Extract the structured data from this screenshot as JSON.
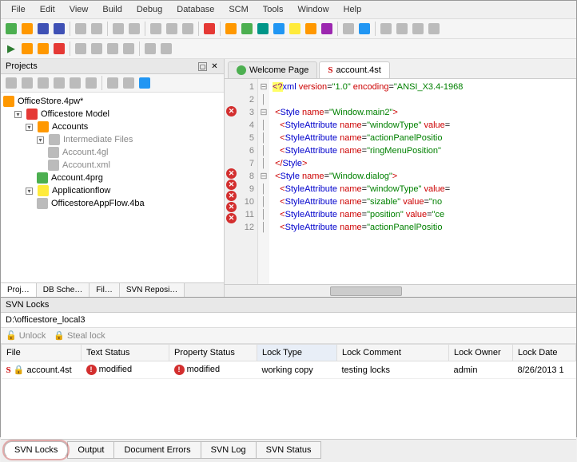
{
  "menu": [
    "File",
    "Edit",
    "View",
    "Build",
    "Debug",
    "Database",
    "SCM",
    "Tools",
    "Window",
    "Help"
  ],
  "projects": {
    "title": "Projects",
    "tabs": [
      "Proj…",
      "DB Sche…",
      "Fil…",
      "SVN Reposi…"
    ],
    "tree": {
      "root": "OfficeStore.4pw*",
      "n1": "Officestore Model",
      "n2": "Accounts",
      "n3": "Intermediate Files",
      "n4a": "Account.4gl",
      "n4b": "Account.xml",
      "n5": "Account.4prg",
      "n6": "Applicationflow",
      "n7": "OfficestoreAppFlow.4ba"
    }
  },
  "editor": {
    "tabs": {
      "welcome": "Welcome Page",
      "file": "account.4st"
    },
    "lines": [
      "1",
      "2",
      "3",
      "4",
      "5",
      "6",
      "7",
      "8",
      "9",
      "10",
      "11",
      "12"
    ]
  },
  "svn": {
    "title": "SVN Locks",
    "path": "D:\\officestore_local3",
    "tool_unlock": "Unlock",
    "tool_steal": "Steal lock",
    "cols": [
      "File",
      "Text Status",
      "Property Status",
      "Lock Type",
      "Lock Comment",
      "Lock Owner",
      "Lock Date"
    ],
    "row": {
      "file": "account.4st",
      "text_status": "modified",
      "prop_status": "modified",
      "lock_type": "working copy",
      "comment": "testing locks",
      "owner": "admin",
      "date": "8/26/2013 1"
    }
  },
  "footer_tabs": [
    "SVN Locks",
    "Output",
    "Document Errors",
    "SVN Log",
    "SVN Status"
  ]
}
